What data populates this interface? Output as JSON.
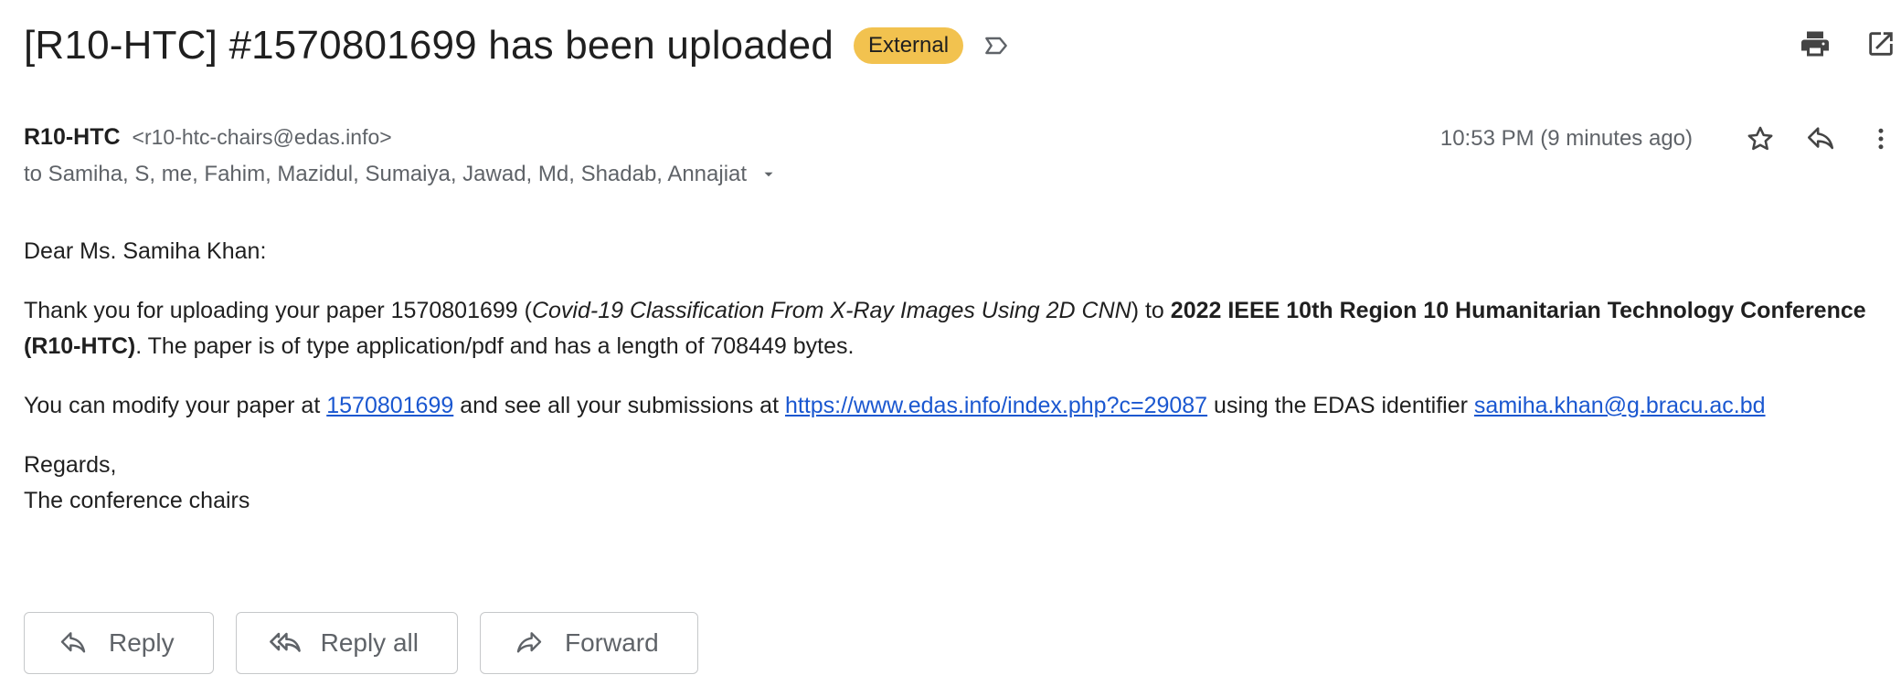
{
  "email": {
    "subject": "[R10-HTC] #1570801699 has been uploaded",
    "badge": "External",
    "sender_name": "R10-HTC",
    "sender_email": "<r10-htc-chairs@edas.info>",
    "recipients": "to Samiha, S, me, Fahim, Mazidul, Sumaiya, Jawad, Md, Shadab, Annajiat",
    "timestamp": "10:53 PM (9 minutes ago)"
  },
  "body": {
    "greeting": "Dear Ms. Samiha Khan:",
    "p1_a": "Thank you for uploading your paper 1570801699 (",
    "p1_title": "Covid-19 Classification From X-Ray Images Using 2D CNN",
    "p1_b": ") to ",
    "p1_conf": "2022 IEEE 10th Region 10 Humanitarian Technology Conference (R10-HTC)",
    "p1_c": ". The paper is of type application/pdf and has a length of 708449 bytes.",
    "p2_a": "You can modify your paper at ",
    "p2_link1": "1570801699",
    "p2_b": " and see all your submissions at ",
    "p2_link2": "https://www.edas.info/index.php?c=29087",
    "p2_c": " using the EDAS identifier ",
    "p2_link3": "samiha.khan@g.bracu.ac.bd",
    "sign1": "Regards,",
    "sign2": "The conference chairs"
  },
  "actions": {
    "reply": "Reply",
    "reply_all": "Reply all",
    "forward": "Forward"
  },
  "icons": {
    "label": "label-icon",
    "print": "print-icon",
    "open_new": "open-in-new-window-icon",
    "star": "star-icon",
    "reply": "reply-icon",
    "more": "more-vertical-icon",
    "dropdown": "caret-down-icon",
    "reply_all": "reply-all-icon",
    "forward": "forward-icon"
  },
  "colors": {
    "badge": "#f2c24f",
    "link": "#1a57d0",
    "muted": "#5f6368"
  }
}
